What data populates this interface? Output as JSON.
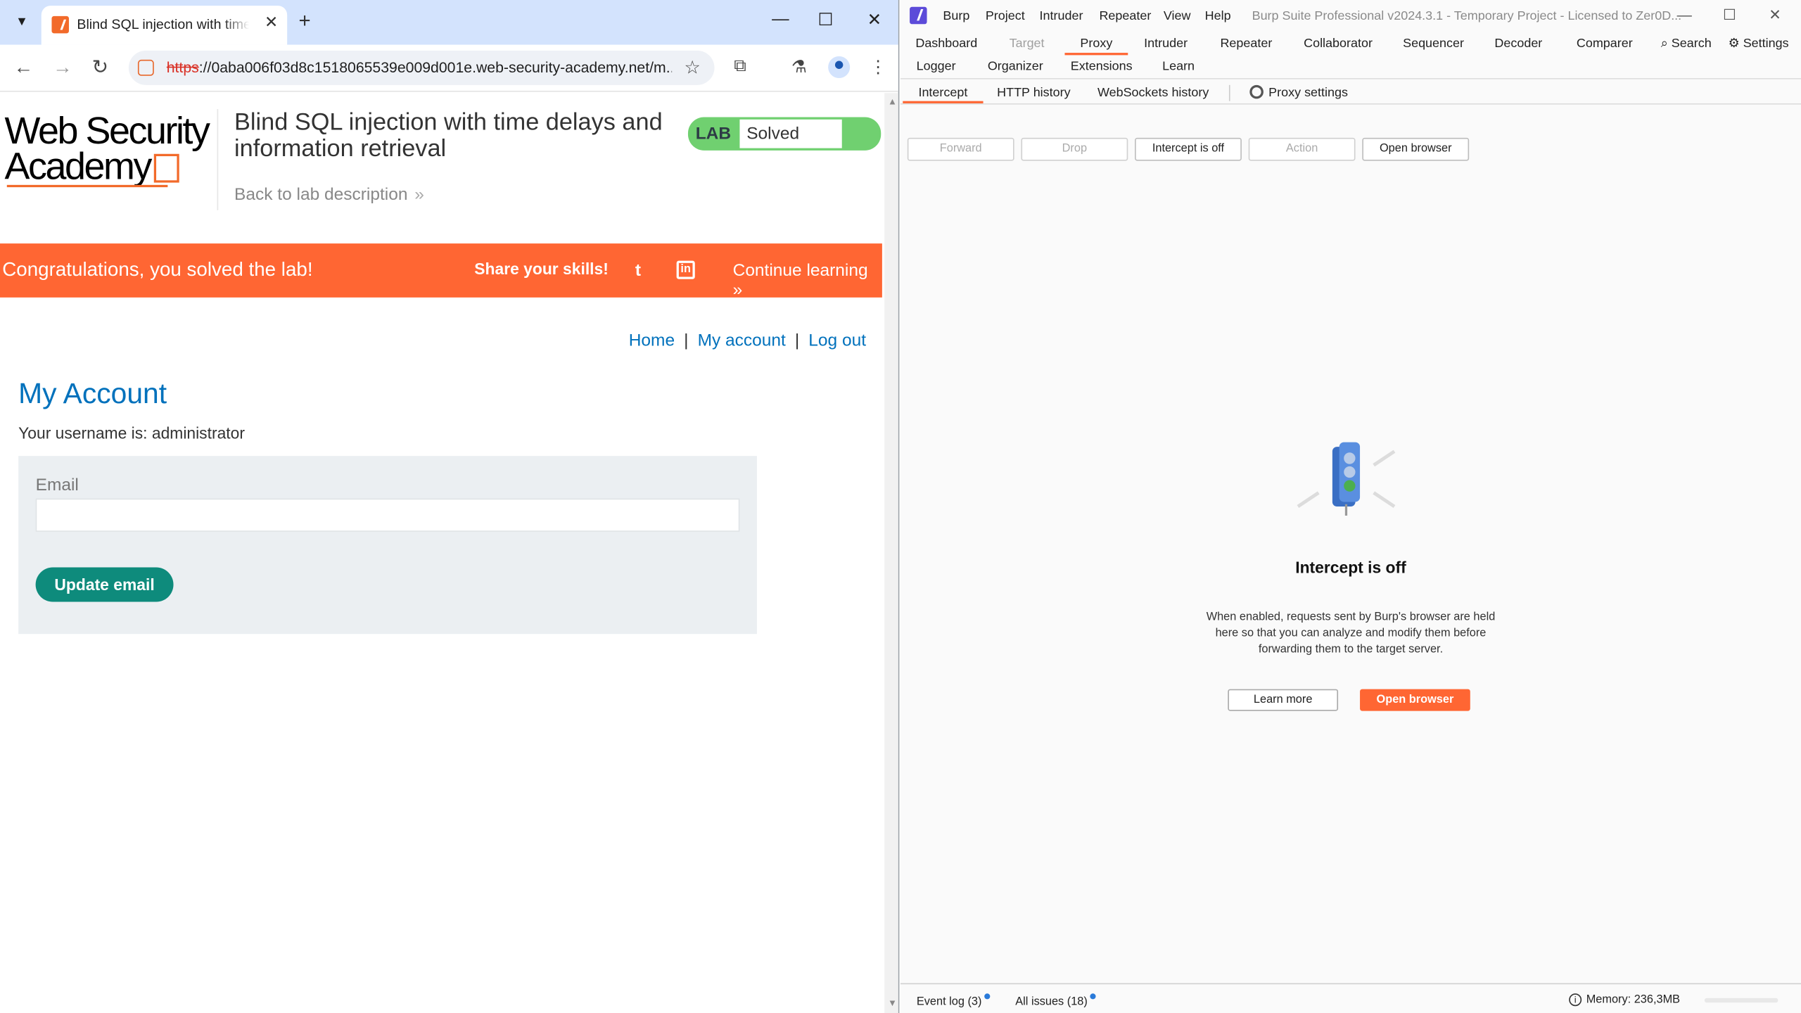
{
  "chrome": {
    "tab_title": "Blind SQL injection with time d",
    "tab_close": "✕",
    "new_tab": "+",
    "url_scheme": "https",
    "url_rest": "://0aba006f03d8c1518065539e009d001e.web-security-academy.net/m...",
    "window_controls": [
      "—",
      "☐",
      "✕"
    ]
  },
  "lab": {
    "logo_line1": "Web Security",
    "logo_line2": "Academy",
    "title": "Blind SQL injection with time delays and information retrieval",
    "back_link": "Back to lab description",
    "badge_label": "LAB",
    "badge_status": "Solved",
    "status_color": "#70d070"
  },
  "banner": {
    "message": "Congratulations, you solved the lab!",
    "share": "Share your skills!",
    "continue": "Continue learning",
    "color": "#ff6633"
  },
  "nav": {
    "home": "Home",
    "account": "My account",
    "logout": "Log out",
    "sep": "|"
  },
  "account": {
    "heading": "My Account",
    "username_line": "Your username is: administrator",
    "email_label": "Email",
    "email_value": "",
    "update_button": "Update email"
  },
  "burp": {
    "menu": [
      "Burp",
      "Project",
      "Intruder",
      "Repeater",
      "View",
      "Help"
    ],
    "window_title": "Burp Suite Professional v2024.3.1 - Temporary Project - Licensed to Zer0D...",
    "tabs_row1": [
      "Dashboard",
      "Target",
      "Proxy",
      "Intruder",
      "Repeater",
      "Collaborator",
      "Sequencer",
      "Decoder",
      "Comparer"
    ],
    "tabs_row2": [
      "Logger",
      "Organizer",
      "Extensions",
      "Learn"
    ],
    "search": "Search",
    "settings": "Settings",
    "subtabs": [
      "Intercept",
      "HTTP history",
      "WebSockets history"
    ],
    "proxy_settings": "Proxy settings",
    "buttons": {
      "forward": "Forward",
      "drop": "Drop",
      "intercept": "Intercept is off",
      "action": "Action",
      "open_browser": "Open browser"
    },
    "heading": "Intercept is off",
    "description": "When enabled, requests sent by Burp's browser are held here so that you can analyze and modify them before forwarding them to the target server.",
    "learn_more": "Learn more",
    "open_browser_cta": "Open browser",
    "event_log": "Event log (3)",
    "all_issues": "All issues (18)",
    "memory": "Memory: 236,3MB",
    "accent": "#ff6633"
  }
}
